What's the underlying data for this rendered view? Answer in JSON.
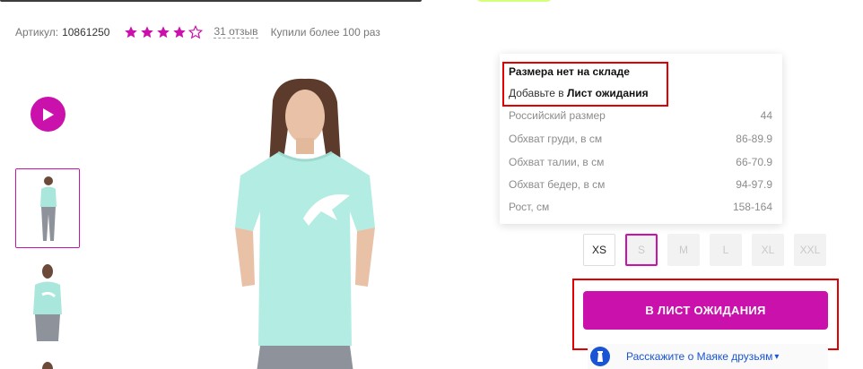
{
  "product": {
    "article_label": "Артикул:",
    "article_value": "10861250",
    "rating": 4,
    "rating_max": 5,
    "reviews_link": "31 отзыв",
    "bought_text": "Купили более 100 раз"
  },
  "colors": {
    "accent": "#cb11ab",
    "highlight": "#e40000",
    "link": "#1954d2"
  },
  "tooltip": {
    "heading": "Размера нет на складе",
    "sub_prefix": "Добавьте в ",
    "sub_bold": "Лист ожидания",
    "rows": [
      {
        "label": "Российский размер",
        "value": "44"
      },
      {
        "label": "Обхват груди, в см",
        "value": "86-89.9"
      },
      {
        "label": "Обхват талии, в см",
        "value": "66-70.9"
      },
      {
        "label": "Обхват бедер, в см",
        "value": "94-97.9"
      },
      {
        "label": "Рост, см",
        "value": "158-164"
      }
    ]
  },
  "sizes": [
    {
      "label": "XS",
      "state": "available"
    },
    {
      "label": "S",
      "state": "selected-unavailable"
    },
    {
      "label": "M",
      "state": "unavailable"
    },
    {
      "label": "L",
      "state": "unavailable"
    },
    {
      "label": "XL",
      "state": "unavailable"
    },
    {
      "label": "XXL",
      "state": "unavailable"
    }
  ],
  "waitlist_button": "В ЛИСТ ОЖИДАНИЯ",
  "share_link": "Расскажите о Маяке друзьям",
  "icons": {
    "play": "play-icon",
    "star": "star-icon",
    "share": "lighthouse-icon",
    "chevron": "chevron-down-icon"
  }
}
